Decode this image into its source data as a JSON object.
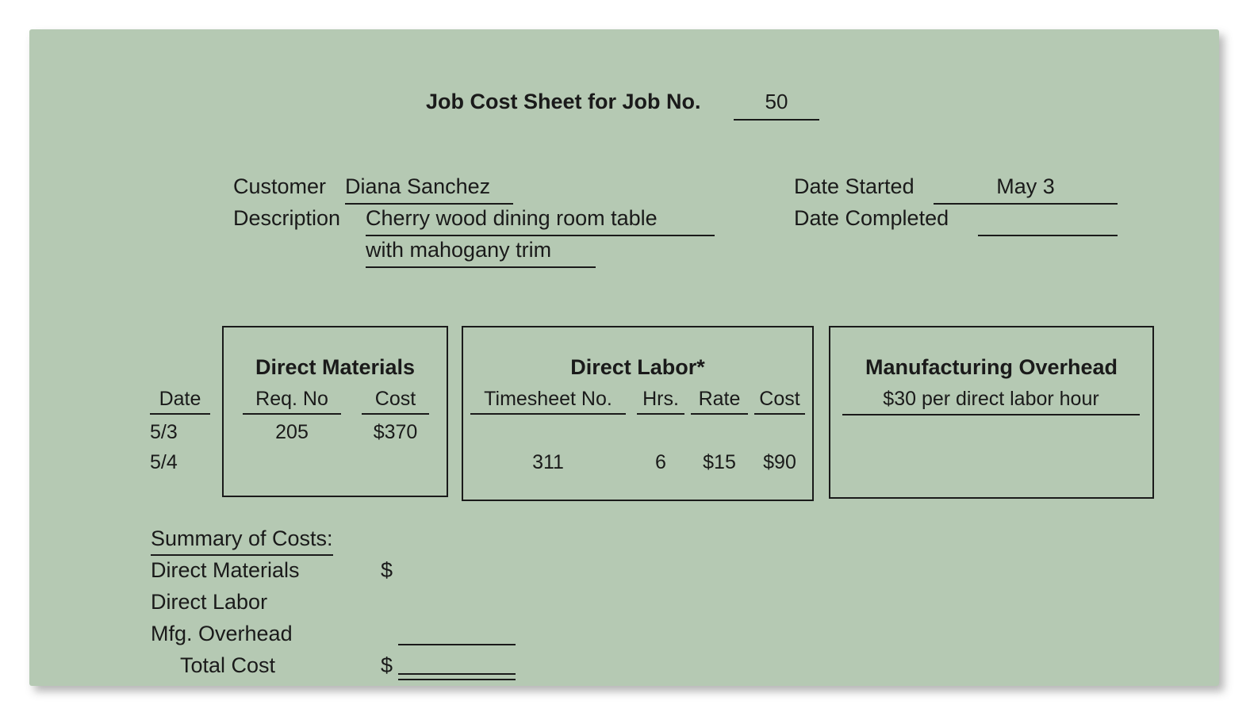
{
  "document": {
    "title_prefix": "Job Cost Sheet for Job No.",
    "job_no": "50",
    "background_color": "#b5c9b3",
    "ink_color": "#1a1a1a"
  },
  "header": {
    "customer_label": "Customer",
    "customer_value": "Diana Sanchez",
    "description_label": "Description",
    "description_line1": "Cherry wood dining room table",
    "description_line2": "with mahogany trim",
    "date_started_label": "Date Started",
    "date_started_value": "May 3",
    "date_completed_label": "Date Completed",
    "date_completed_value": ""
  },
  "date_column": {
    "header": "Date",
    "values": [
      "5/3",
      "5/4"
    ]
  },
  "direct_materials": {
    "title": "Direct Materials",
    "columns": [
      "Req. No",
      "Cost"
    ],
    "rows": [
      {
        "req_no": "205",
        "cost": "$370"
      },
      {
        "req_no": "",
        "cost": ""
      }
    ]
  },
  "direct_labor": {
    "title": "Direct Labor*",
    "columns": [
      "Timesheet No.",
      "Hrs.",
      "Rate",
      "Cost"
    ],
    "rows": [
      {
        "timesheet_no": "",
        "hrs": "",
        "rate": "",
        "cost": ""
      },
      {
        "timesheet_no": "311",
        "hrs": "6",
        "rate": "$15",
        "cost": "$90"
      }
    ]
  },
  "manufacturing_overhead": {
    "title": "Manufacturing Overhead",
    "rate": "$30 per direct labor hour"
  },
  "summary": {
    "title": "Summary of Costs:",
    "rows": [
      {
        "label": "Direct Materials",
        "dollar_sign": "$",
        "amount": ""
      },
      {
        "label": "Direct Labor",
        "dollar_sign": "",
        "amount": ""
      },
      {
        "label": "Mfg. Overhead",
        "dollar_sign": "",
        "amount": ""
      },
      {
        "label": "Total Cost",
        "dollar_sign": "$",
        "amount": ""
      }
    ]
  }
}
